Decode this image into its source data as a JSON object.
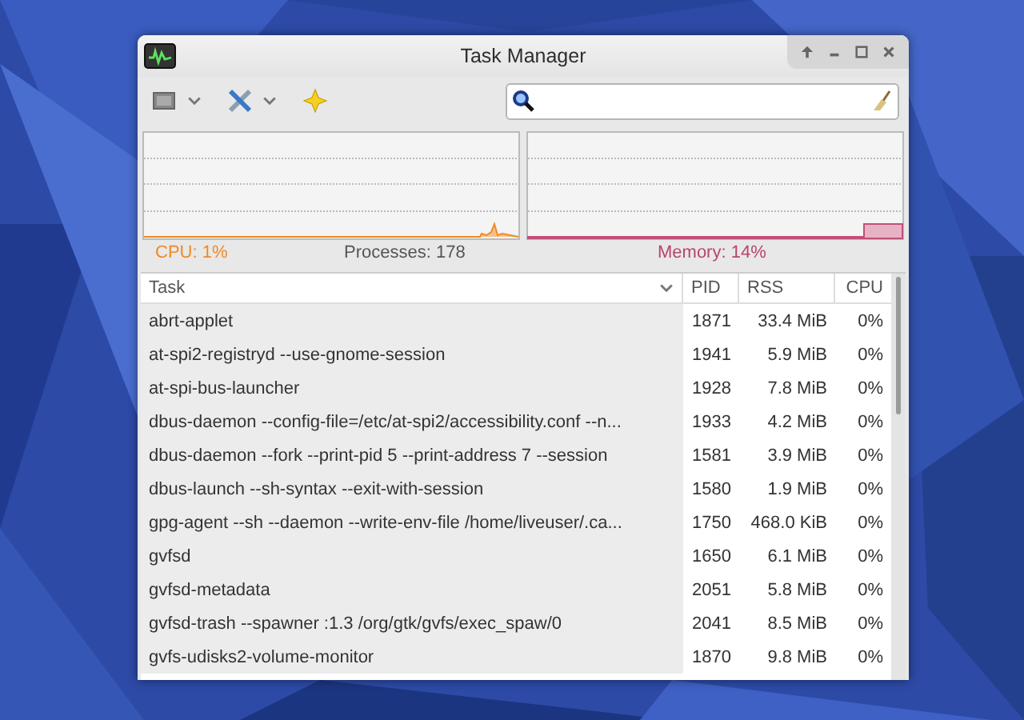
{
  "window": {
    "title": "Task Manager"
  },
  "monitor": {
    "cpu": "CPU: 1%",
    "processes": "Processes: 178",
    "memory": "Memory: 14%"
  },
  "table": {
    "columns": [
      {
        "label": "Task",
        "sorted": true
      },
      {
        "label": "PID",
        "sorted": false
      },
      {
        "label": "RSS",
        "sorted": false
      },
      {
        "label": "CPU",
        "sorted": false
      }
    ],
    "rows": [
      [
        "abrt-applet",
        "1871",
        "33.4 MiB",
        "0%"
      ],
      [
        "at-spi2-registryd --use-gnome-session",
        "1941",
        "5.9 MiB",
        "0%"
      ],
      [
        "at-spi-bus-launcher",
        "1928",
        "7.8 MiB",
        "0%"
      ],
      [
        "dbus-daemon --config-file=/etc/at-spi2/accessibility.conf --n...",
        "1933",
        "4.2 MiB",
        "0%"
      ],
      [
        "dbus-daemon --fork --print-pid 5 --print-address 7 --session",
        "1581",
        "3.9 MiB",
        "0%"
      ],
      [
        "dbus-launch --sh-syntax --exit-with-session",
        "1580",
        "1.9 MiB",
        "0%"
      ],
      [
        "gpg-agent --sh --daemon --write-env-file /home/liveuser/.ca...",
        "1750",
        "468.0 KiB",
        "0%"
      ],
      [
        "gvfsd",
        "1650",
        "6.1 MiB",
        "0%"
      ],
      [
        "gvfsd-metadata",
        "2051",
        "5.8 MiB",
        "0%"
      ],
      [
        "gvfsd-trash --spawner :1.3 /org/gtk/gvfs/exec_spaw/0",
        "2041",
        "8.5 MiB",
        "0%"
      ],
      [
        "gvfs-udisks2-volume-monitor",
        "1870",
        "9.8 MiB",
        "0%"
      ]
    ]
  }
}
